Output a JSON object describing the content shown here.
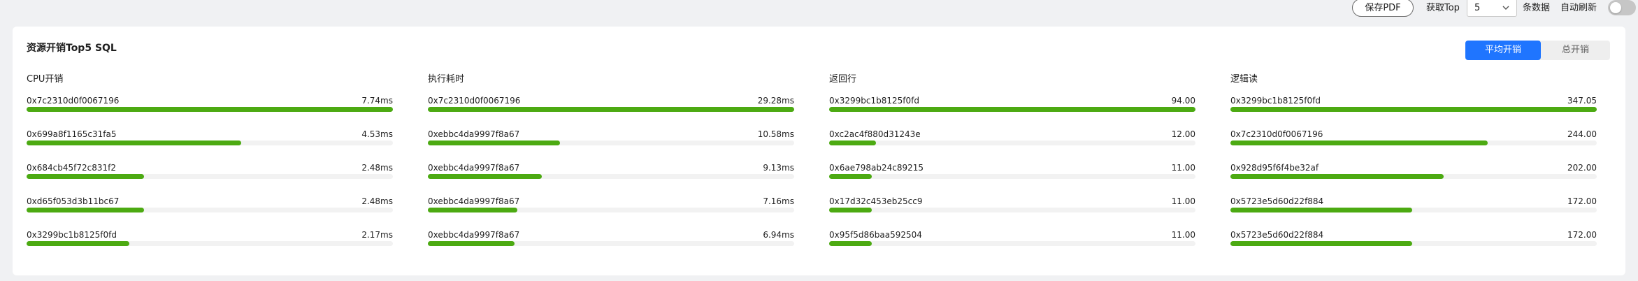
{
  "toolbar": {
    "save_pdf_label": "保存PDF",
    "get_top_label": "获取Top",
    "top_value": "5",
    "rows_label": "条数据",
    "auto_refresh_label": "自动刷新",
    "auto_refresh_on": false
  },
  "card": {
    "title": "资源开销Top5 SQL",
    "toggle": {
      "active_label": "平均开销",
      "inactive_label": "总开销"
    }
  },
  "columns": [
    {
      "title": "CPU开销",
      "rows": [
        {
          "id": "0x7c2310d0f0067196",
          "value": "7.74ms",
          "percent": 100
        },
        {
          "id": "0x699a8f1165c31fa5",
          "value": "4.53ms",
          "percent": 58.5
        },
        {
          "id": "0x684cb45f72c831f2",
          "value": "2.48ms",
          "percent": 32.0
        },
        {
          "id": "0xd65f053d3b11bc67",
          "value": "2.48ms",
          "percent": 32.0
        },
        {
          "id": "0x3299bc1b8125f0fd",
          "value": "2.17ms",
          "percent": 28.0
        }
      ]
    },
    {
      "title": "执行耗时",
      "rows": [
        {
          "id": "0x7c2310d0f0067196",
          "value": "29.28ms",
          "percent": 100
        },
        {
          "id": "0xebbc4da9997f8a67",
          "value": "10.58ms",
          "percent": 36.1
        },
        {
          "id": "0xebbc4da9997f8a67",
          "value": "9.13ms",
          "percent": 31.2
        },
        {
          "id": "0xebbc4da9997f8a67",
          "value": "7.16ms",
          "percent": 24.5
        },
        {
          "id": "0xebbc4da9997f8a67",
          "value": "6.94ms",
          "percent": 23.7
        }
      ]
    },
    {
      "title": "返回行",
      "rows": [
        {
          "id": "0x3299bc1b8125f0fd",
          "value": "94.00",
          "percent": 100
        },
        {
          "id": "0xc2ac4f880d31243e",
          "value": "12.00",
          "percent": 12.8
        },
        {
          "id": "0x6ae798ab24c89215",
          "value": "11.00",
          "percent": 11.7
        },
        {
          "id": "0x17d32c453eb25cc9",
          "value": "11.00",
          "percent": 11.7
        },
        {
          "id": "0x95f5d86baa592504",
          "value": "11.00",
          "percent": 11.7
        }
      ]
    },
    {
      "title": "逻辑读",
      "rows": [
        {
          "id": "0x3299bc1b8125f0fd",
          "value": "347.05",
          "percent": 100
        },
        {
          "id": "0x7c2310d0f0067196",
          "value": "244.00",
          "percent": 70.3
        },
        {
          "id": "0x928d95f6f4be32af",
          "value": "202.00",
          "percent": 58.2
        },
        {
          "id": "0x5723e5d60d22f884",
          "value": "172.00",
          "percent": 49.6
        },
        {
          "id": "0x5723e5d60d22f884",
          "value": "172.00",
          "percent": 49.6
        }
      ]
    }
  ],
  "colors": {
    "bar_fill": "#4caa12",
    "bar_track": "#f2f2f2",
    "accent": "#1f75ff"
  }
}
